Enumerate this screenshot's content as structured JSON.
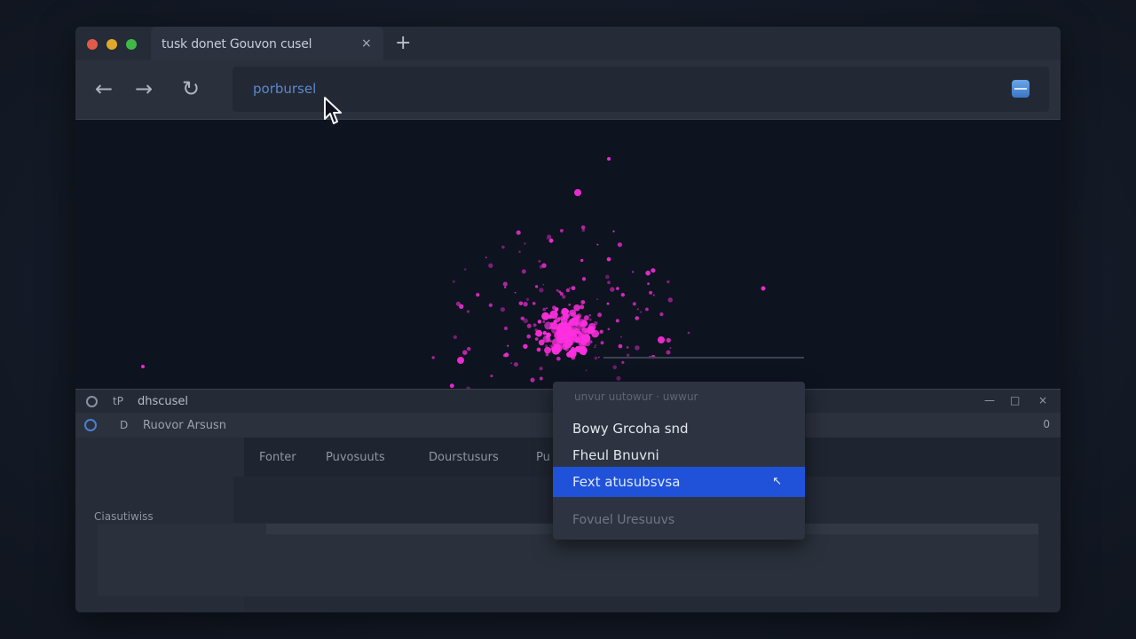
{
  "window": {
    "traffic_lights": [
      "#e05a4c",
      "#e0a82a",
      "#3fb84a"
    ]
  },
  "tab": {
    "title": "tusk donet Gouvon cusel",
    "close_glyph": "×",
    "new_tab_glyph": "+"
  },
  "toolbar": {
    "back_glyph": "←",
    "forward_glyph": "→",
    "reload_glyph": "↻",
    "address_text": "porbursel"
  },
  "devtools": {
    "header_tp": "tP",
    "header_title": "dhscusel",
    "minimize_glyph": "—",
    "restore_glyph": "□",
    "close_glyph": "×",
    "sub_label_d": "D",
    "sub_label": "Ruovor Arsusn",
    "sub_right": "0",
    "tabs": [
      "Fonter",
      "Puvosuuts",
      "Dourstusurs",
      "Pu"
    ],
    "sidebar_label": "Ciasutiwiss"
  },
  "context_menu": {
    "header": "unvur uutowur · uwwur",
    "items": [
      {
        "label": "Bowy Grcoha snd",
        "state": "normal"
      },
      {
        "label": "Fheul Bnuvni",
        "state": "normal"
      },
      {
        "label": "Fext atusubsvsa",
        "state": "highlighted",
        "mark": "↖"
      },
      {
        "label": "Fovuel Uresuuvs",
        "state": "disabled"
      }
    ]
  },
  "visualization": {
    "particle_color": "#ff2fe0"
  }
}
